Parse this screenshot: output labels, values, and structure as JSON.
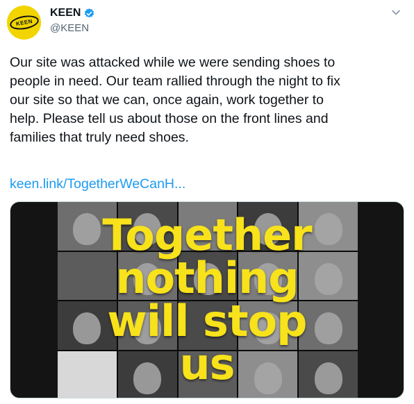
{
  "author": {
    "display_name": "KEEN",
    "handle": "@KEEN",
    "avatar_text": "KEEN",
    "verified": true,
    "avatar_color": "#f2d500"
  },
  "tweet": {
    "text": "Our site was attacked while we were sending shoes to\npeople in need. Our team rallied through the night to fix\nour site so that we can, once again, work together to\nhelp. Please tell us about those on the front lines and\nfamilies that truly need shoes.",
    "link_text": "keen.link/TogetherWeCanH..."
  },
  "media": {
    "overlay_lines": [
      "Together",
      "nothing",
      "will stop",
      "us"
    ],
    "overlay_color": "#f7e21b"
  },
  "colors": {
    "link": "#1d9bf0",
    "verified_badge": "#1d9bf0",
    "secondary_text": "#536471"
  },
  "icons": {
    "verified": "verified-badge-icon",
    "more": "chevron-down-icon"
  }
}
